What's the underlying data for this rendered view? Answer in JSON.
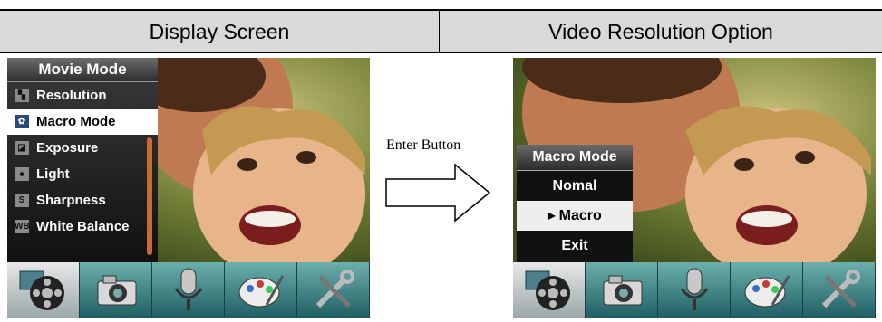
{
  "headers": {
    "left": "Display Screen",
    "right": "Video Resolution Option"
  },
  "left_menu": {
    "title": "Movie Mode",
    "items": [
      {
        "label": "Resolution",
        "icon": "resolution-icon",
        "glyph": "▚",
        "selected": false
      },
      {
        "label": "Macro Mode",
        "icon": "macro-icon",
        "glyph": "✿",
        "selected": true
      },
      {
        "label": "Exposure",
        "icon": "exposure-icon",
        "glyph": "◪",
        "selected": false
      },
      {
        "label": "Light",
        "icon": "light-icon",
        "glyph": "♠",
        "selected": false
      },
      {
        "label": "Sharpness",
        "icon": "sharpness-icon",
        "glyph": "S",
        "selected": false
      },
      {
        "label": "White Balance",
        "icon": "white-balance-icon",
        "glyph": "WB",
        "selected": false
      }
    ]
  },
  "enter_label": "Enter Button",
  "right_popup": {
    "title": "Macro Mode",
    "options": [
      {
        "label": "Nomal",
        "selected": false
      },
      {
        "label": "▸ Macro",
        "selected": true
      },
      {
        "label": "Exit",
        "selected": false
      }
    ]
  },
  "toolbar": {
    "icons": [
      "movie-reel-icon",
      "camera-icon",
      "microphone-icon",
      "palette-icon",
      "tools-icon"
    ],
    "active": "movie-reel-icon"
  },
  "colors": {
    "header_bg": "#d9d9d9",
    "toolbar": "#2f7b7e",
    "highlight": "#ffffff",
    "scrollbar": "#c86a34"
  }
}
